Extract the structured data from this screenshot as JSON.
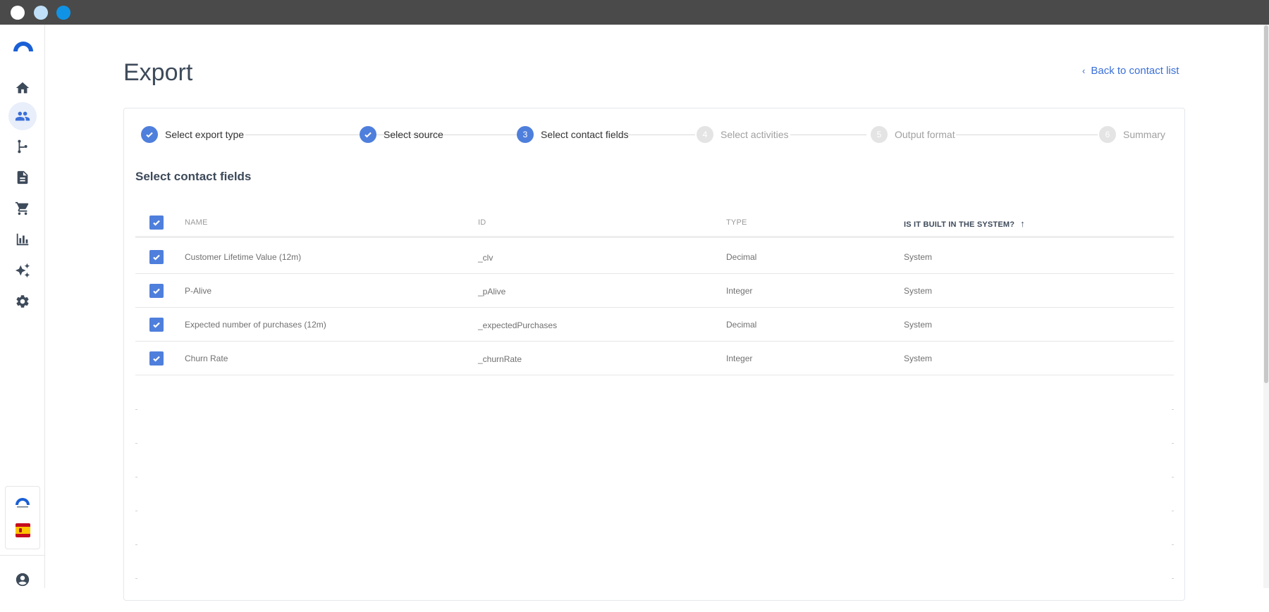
{
  "page": {
    "title": "Export",
    "back_link": "Back to contact list"
  },
  "stepper": [
    {
      "number": "1",
      "label": "Select export type",
      "state": "done"
    },
    {
      "number": "2",
      "label": "Select source",
      "state": "done"
    },
    {
      "number": "3",
      "label": "Select contact fields",
      "state": "current"
    },
    {
      "number": "4",
      "label": "Select activities",
      "state": "pending"
    },
    {
      "number": "5",
      "label": "Output format",
      "state": "pending"
    },
    {
      "number": "6",
      "label": "Summary",
      "state": "pending"
    }
  ],
  "section": {
    "title": "Select contact fields"
  },
  "table": {
    "headers": {
      "name": "NAME",
      "id": "ID",
      "type": "TYPE",
      "builtin": "IS IT BUILT IN THE SYSTEM?"
    },
    "sort": {
      "column": "builtin",
      "direction": "ascending",
      "icon": "arrow-up-icon"
    },
    "select_all_checked": true,
    "rows": [
      {
        "checked": true,
        "name": "Customer Lifetime Value (12m)",
        "id": "_clv",
        "type": "Decimal",
        "builtin": "System"
      },
      {
        "checked": true,
        "name": "P-Alive",
        "id": "_pAlive",
        "type": "Integer",
        "builtin": "System"
      },
      {
        "checked": true,
        "name": "Expected number of purchases (12m)",
        "id": "_expectedPurchases",
        "type": "Decimal",
        "builtin": "System"
      },
      {
        "checked": true,
        "name": "Churn Rate",
        "id": "_churnRate",
        "type": "Integer",
        "builtin": "System"
      }
    ]
  },
  "sidebar": {
    "items": [
      {
        "icon": "home-icon",
        "active": false
      },
      {
        "icon": "contacts-icon",
        "active": true
      },
      {
        "icon": "flow-icon",
        "active": false
      },
      {
        "icon": "document-icon",
        "active": false
      },
      {
        "icon": "cart-icon",
        "active": false
      },
      {
        "icon": "bar-chart-icon",
        "active": false
      },
      {
        "icon": "sparkles-icon",
        "active": false
      },
      {
        "icon": "gear-icon",
        "active": false
      }
    ],
    "language_flag": "spain-flag-icon",
    "profile_icon": "account-circle-icon"
  },
  "colors": {
    "accent": "#4f7fdc",
    "link": "#3a6fd8",
    "titlebar": "#4a4a4a"
  }
}
